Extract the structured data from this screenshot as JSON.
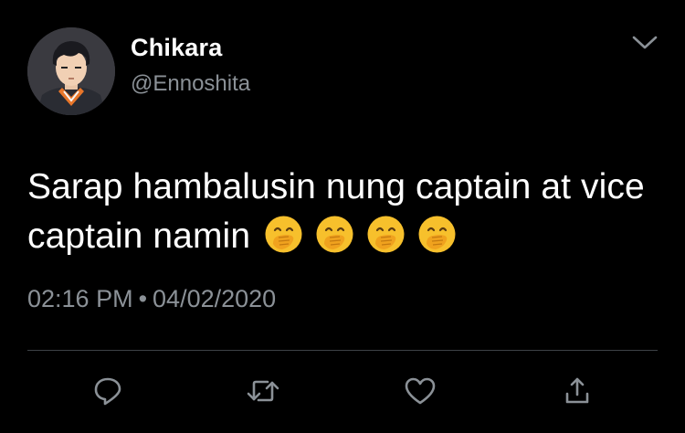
{
  "user": {
    "display_name": "Chikara",
    "handle": "@Ennoshita",
    "avatar_icon": "anime-character-avatar"
  },
  "tweet": {
    "text": "Sarap hambalusin nung captain at vice captain namin",
    "emojis": [
      "🤭",
      "🤭",
      "🤭",
      "🤭"
    ]
  },
  "meta": {
    "time": "02:16 PM",
    "separator": "•",
    "date": "04/02/2020"
  },
  "actions": [
    {
      "icon": "reply-icon"
    },
    {
      "icon": "retweet-icon"
    },
    {
      "icon": "like-icon"
    },
    {
      "icon": "share-icon"
    }
  ],
  "colors": {
    "background": "#000000",
    "primary_text": "#ffffff",
    "secondary_text": "#8b9197",
    "divider": "#3d4247"
  }
}
